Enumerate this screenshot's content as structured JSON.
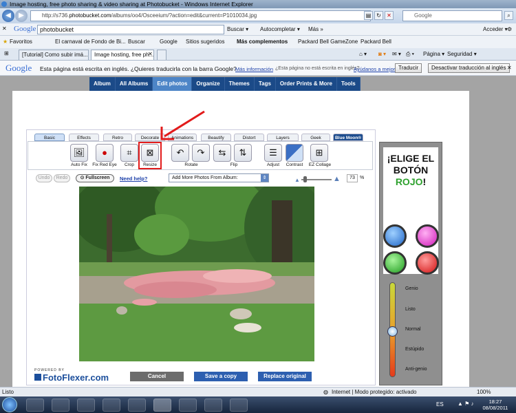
{
  "window": {
    "title": "Image hosting, free photo sharing & video sharing at Photobucket - Windows Internet Explorer"
  },
  "address": {
    "url_prefix": "http://s736.",
    "url_domain": "photobucket.com",
    "url_path": "/albums/oo4/Osceeium/?action=edit&current=P1010034.jpg",
    "search_placeholder": "Google"
  },
  "google_toolbar": {
    "logo": "Google",
    "query": "photobucket",
    "search": "Buscar",
    "autofill": "Autocompletar",
    "more": "Más",
    "signin": "Acceder"
  },
  "favorites": {
    "label": "Favoritos",
    "items": [
      "El carnaval de Fondo de Bi...",
      "Buscar",
      "Google",
      "Sitios sugeridos",
      "Más complementos",
      "Packard Bell GameZone",
      "Packard Bell"
    ]
  },
  "browser_tabs": [
    {
      "label": "[Tutorial] Como subir imá..."
    },
    {
      "label": "Image hosting, free ph..."
    }
  ],
  "tab_tools": {
    "page": "Página",
    "security": "Seguridad"
  },
  "translate_bar": {
    "logo": "Google",
    "message": "Esta página está escrita en inglés. ¿Quieres traducirla con la barra Google?",
    "more_info": "Más información",
    "question": "¿Esta página no está escrita en inglés?",
    "help": "Ayúdanos a mejorar",
    "translate": "Traducir",
    "disable": "Desactivar traducción al inglés"
  },
  "site_nav": [
    "Album",
    "All Albums",
    "Edit photos",
    "Organize",
    "Themes",
    "Tags",
    "Order Prints & More",
    "Tools"
  ],
  "editor": {
    "tabs": [
      "Basic",
      "Effects",
      "Retro",
      "Decorate",
      "Animations",
      "Beautify",
      "Distort",
      "Layers",
      "Geek",
      "Blue Moon®"
    ],
    "tools": [
      "Auto Fix",
      "Fix Red Eye",
      "Crop",
      "Resize",
      "Rotate",
      "Flip",
      "Adjust",
      "Contrast",
      "EZ Collage"
    ],
    "undo": "Undo",
    "redo": "Redo",
    "fullscreen": "Fullscreen",
    "need_help": "Need help?",
    "add_photos": "Add More Photos From Album:",
    "zoom": "73",
    "zoom_unit": "%",
    "powered_by": "POWERED BY",
    "brand": "FotoFlexer.com",
    "cancel": "Cancel",
    "save_copy": "Save a copy",
    "replace": "Replace original"
  },
  "ad": {
    "line1": "¡ELIGE EL",
    "line2": "BOTÓN",
    "line3": "ROJO",
    "excl": "!",
    "scale": [
      "Genio",
      "Listo",
      "Normal",
      "Estúpido",
      "Anti-genio"
    ]
  },
  "status": {
    "left": "Listo",
    "zone": "Internet | Modo protegido: activado",
    "zoom": "100%"
  },
  "taskbar": {
    "lang": "ES",
    "time": "18:27",
    "date": "08/08/2011"
  },
  "colors": {
    "pb_nav": "#1b4a88",
    "pb_active": "#4d85c7",
    "highlight": "#e21b1b"
  }
}
